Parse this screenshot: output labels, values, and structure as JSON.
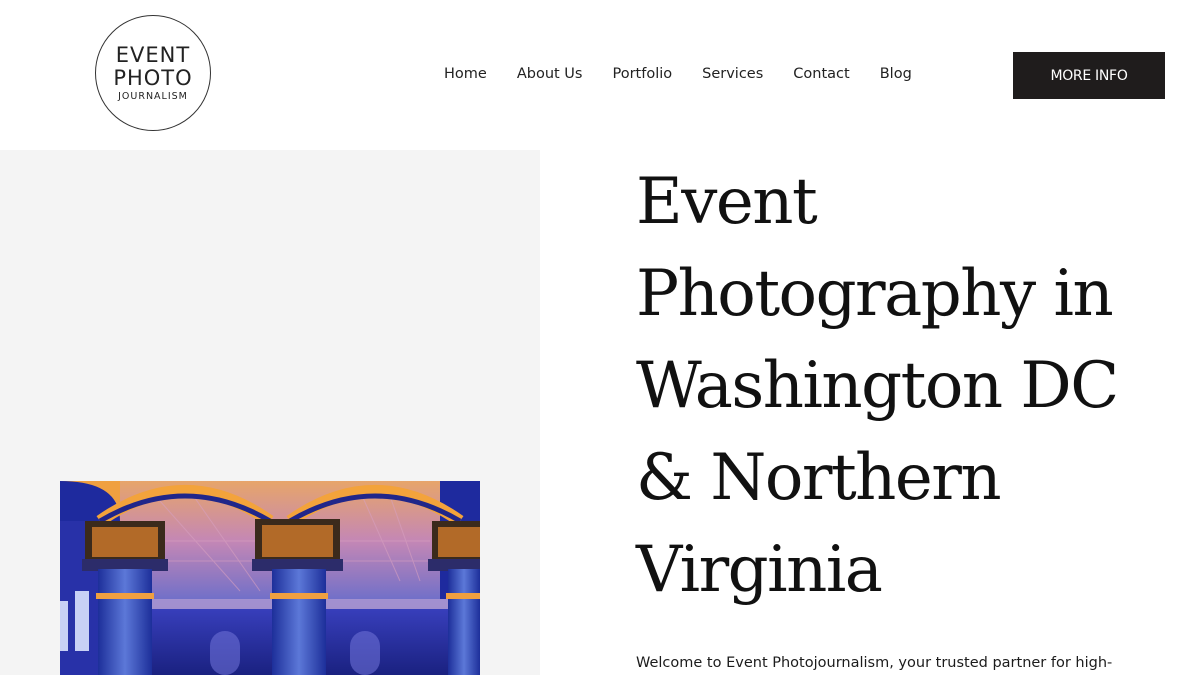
{
  "logo": {
    "line1": "EVENT",
    "line2": "PHOTO",
    "line3": "JOURNALISM"
  },
  "nav": {
    "items": [
      {
        "label": "Home"
      },
      {
        "label": "About Us"
      },
      {
        "label": "Portfolio"
      },
      {
        "label": "Services"
      },
      {
        "label": "Contact"
      },
      {
        "label": "Blog"
      }
    ]
  },
  "header": {
    "cta_label": "MORE INFO"
  },
  "hero": {
    "title": "Event Photography in Washington DC & Northern Virginia",
    "intro": "Welcome to Event Photojournalism, your trusted partner for high-"
  },
  "colors": {
    "cta_bg": "#1f1c1c",
    "panel_bg": "#f4f4f4",
    "text": "#111111"
  }
}
